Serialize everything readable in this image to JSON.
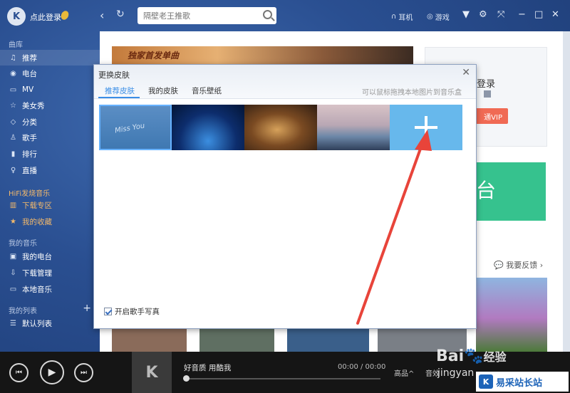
{
  "titlebar": {
    "login": "点此登录",
    "search_placeholder": "隔壁老王推歌",
    "earphone": "耳机",
    "game": "游戏"
  },
  "sidebar": {
    "section_library": "曲库",
    "items_library": [
      {
        "label": "推荐",
        "icon": "♫"
      },
      {
        "label": "电台",
        "icon": "📡"
      },
      {
        "label": "MV",
        "icon": "▭"
      },
      {
        "label": "美女秀",
        "icon": "☆"
      },
      {
        "label": "分类",
        "icon": "◇"
      },
      {
        "label": "歌手",
        "icon": "♙"
      },
      {
        "label": "排行",
        "icon": "▮"
      },
      {
        "label": "直播",
        "icon": "♀"
      }
    ],
    "section_hifi": "HiFi发烧音乐",
    "items_hifi": [
      {
        "label": "下载专区",
        "icon": "▥"
      },
      {
        "label": "我的收藏",
        "icon": "★"
      }
    ],
    "section_my": "我的音乐",
    "items_my": [
      {
        "label": "我的电台",
        "icon": "▣"
      },
      {
        "label": "下载管理",
        "icon": "⇩"
      },
      {
        "label": "本地音乐",
        "icon": "▭"
      }
    ],
    "section_lists": "我的列表",
    "items_lists": [
      {
        "label": "默认列表",
        "icon": "☰"
      }
    ]
  },
  "main": {
    "banner_title": "独家首发单曲",
    "login_card_text": "登录",
    "vip_label": "通VIP",
    "radio_label": "台",
    "feedback": "我要反馈"
  },
  "dialog": {
    "title": "更换皮肤",
    "tabs": [
      "推荐皮肤",
      "我的皮肤",
      "音乐壁纸"
    ],
    "hint": "可以鼠标拖拽本地图片到音乐盒",
    "skin_text": "Miss You",
    "checkbox_label": "开启歌手写真"
  },
  "player": {
    "song": "好音质 用酷我",
    "time": "00:00 / 00:00",
    "quality": "高品",
    "effect": "音效",
    "progress": 0
  },
  "watermark": {
    "baidu": "Bai",
    "baidu_suffix": "经验",
    "jingyan": "jingyan",
    "site": "易采站长站"
  }
}
